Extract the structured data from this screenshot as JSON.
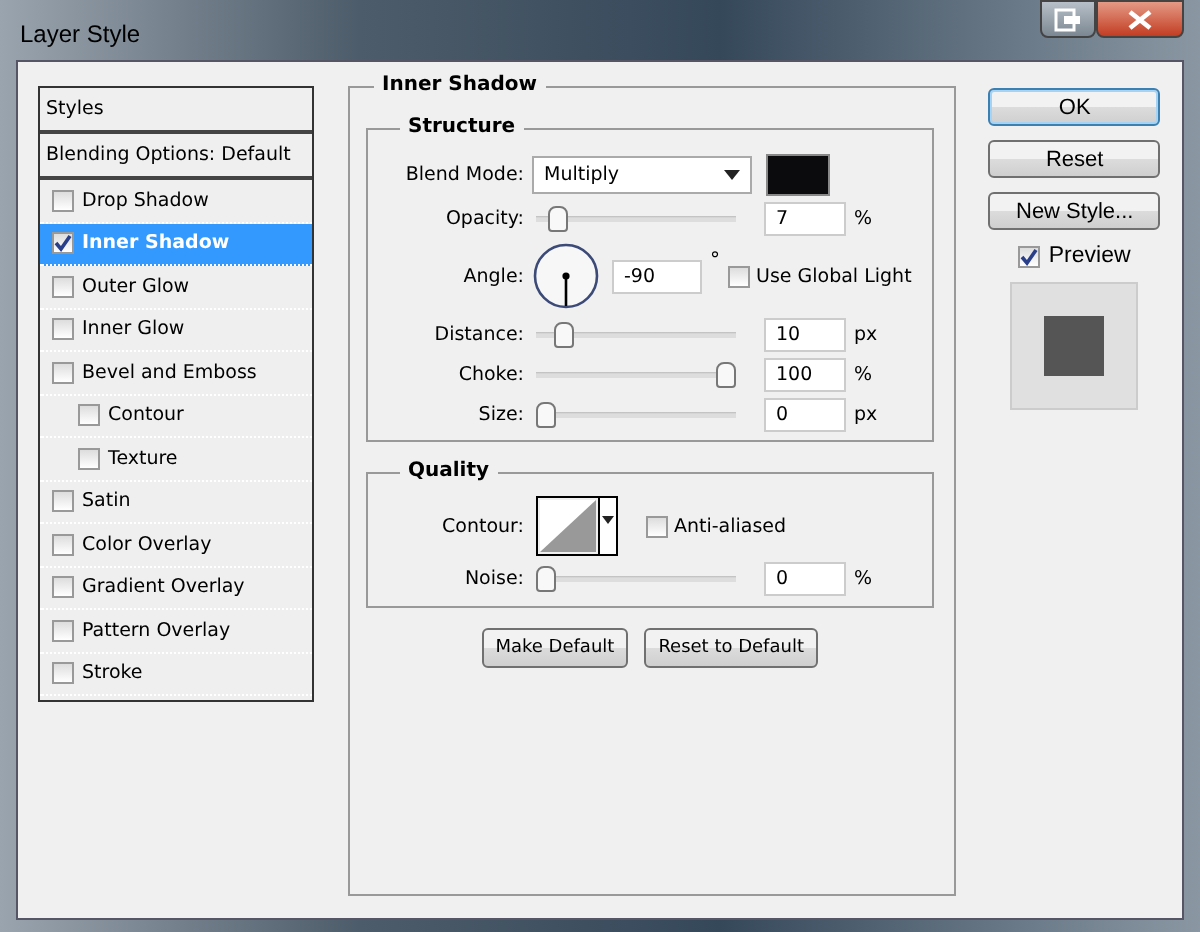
{
  "window": {
    "title": "Layer Style"
  },
  "styles_header": "Styles",
  "blending_options": "Blending Options: Default",
  "styles": [
    {
      "label": "Drop Shadow",
      "checked": false,
      "selected": false
    },
    {
      "label": "Inner Shadow",
      "checked": true,
      "selected": true
    },
    {
      "label": "Outer Glow",
      "checked": false,
      "selected": false
    },
    {
      "label": "Inner Glow",
      "checked": false,
      "selected": false
    },
    {
      "label": "Bevel and Emboss",
      "checked": false,
      "selected": false,
      "children": [
        {
          "label": "Contour",
          "checked": false,
          "selected": false
        },
        {
          "label": "Texture",
          "checked": false,
          "selected": false
        }
      ]
    },
    {
      "label": "Satin",
      "checked": false,
      "selected": false
    },
    {
      "label": "Color Overlay",
      "checked": false,
      "selected": false
    },
    {
      "label": "Gradient Overlay",
      "checked": false,
      "selected": false
    },
    {
      "label": "Pattern Overlay",
      "checked": false,
      "selected": false
    },
    {
      "label": "Stroke",
      "checked": false,
      "selected": false
    }
  ],
  "panel_title": "Inner Shadow",
  "structure": {
    "title": "Structure",
    "blend_mode": {
      "label": "Blend Mode:",
      "value": "Multiply",
      "color": "#0b0b0d"
    },
    "rows": [
      {
        "kind": "slider",
        "label": "Opacity:",
        "level": 0.07,
        "value": "7",
        "unit": "%"
      },
      {
        "kind": "angle",
        "label": "Angle:",
        "value": "-90",
        "unit": "°",
        "checkbox": {
          "label": "Use Global Light",
          "checked": false
        }
      },
      {
        "kind": "slider",
        "label": "Distance:",
        "level": 0.1,
        "value": "10",
        "unit": "px"
      },
      {
        "kind": "slider",
        "label": "Choke:",
        "level": 1,
        "value": "100",
        "unit": "%"
      },
      {
        "kind": "slider",
        "label": "Size:",
        "level": 0,
        "value": "0",
        "unit": "px"
      }
    ]
  },
  "quality": {
    "title": "Quality",
    "contour_label": "Contour:",
    "anti_aliased": {
      "label": "Anti-aliased",
      "checked": false
    },
    "noise": {
      "label": "Noise:",
      "level": 0,
      "value": "0",
      "unit": "%"
    }
  },
  "panel_buttons": [
    "Make Default",
    "Reset to Default"
  ],
  "buttons": [
    "OK",
    "Reset",
    "New Style..."
  ],
  "preview": {
    "label": "Preview",
    "checked": true
  }
}
